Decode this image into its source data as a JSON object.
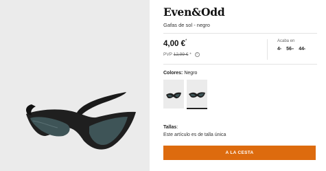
{
  "product": {
    "brand": "Even&Odd",
    "subtitle": "Gafas de sol - negro",
    "image_icon": "sunglasses-product-photo"
  },
  "pricing": {
    "price": "4,00 €",
    "price_marker": "*",
    "pvp_prefix": "PVP",
    "pvp_old": "12,99 €",
    "pvp_marker": "*",
    "info_icon": "info-icon"
  },
  "countdown": {
    "label": "Acaba en",
    "hours": "4",
    "hours_unit": "h",
    "minutes": "56",
    "minutes_unit": "m",
    "seconds": "44",
    "seconds_unit": "s"
  },
  "colors": {
    "label": "Colores:",
    "selected": "Negro",
    "swatches": [
      {
        "name": "swatch-1"
      },
      {
        "name": "swatch-2",
        "selected": true
      }
    ]
  },
  "sizes": {
    "label": "Tallas",
    "note": "Este artículo es de talla única"
  },
  "cta": {
    "label": "A LA CESTA",
    "color": "#dd6b0e"
  }
}
